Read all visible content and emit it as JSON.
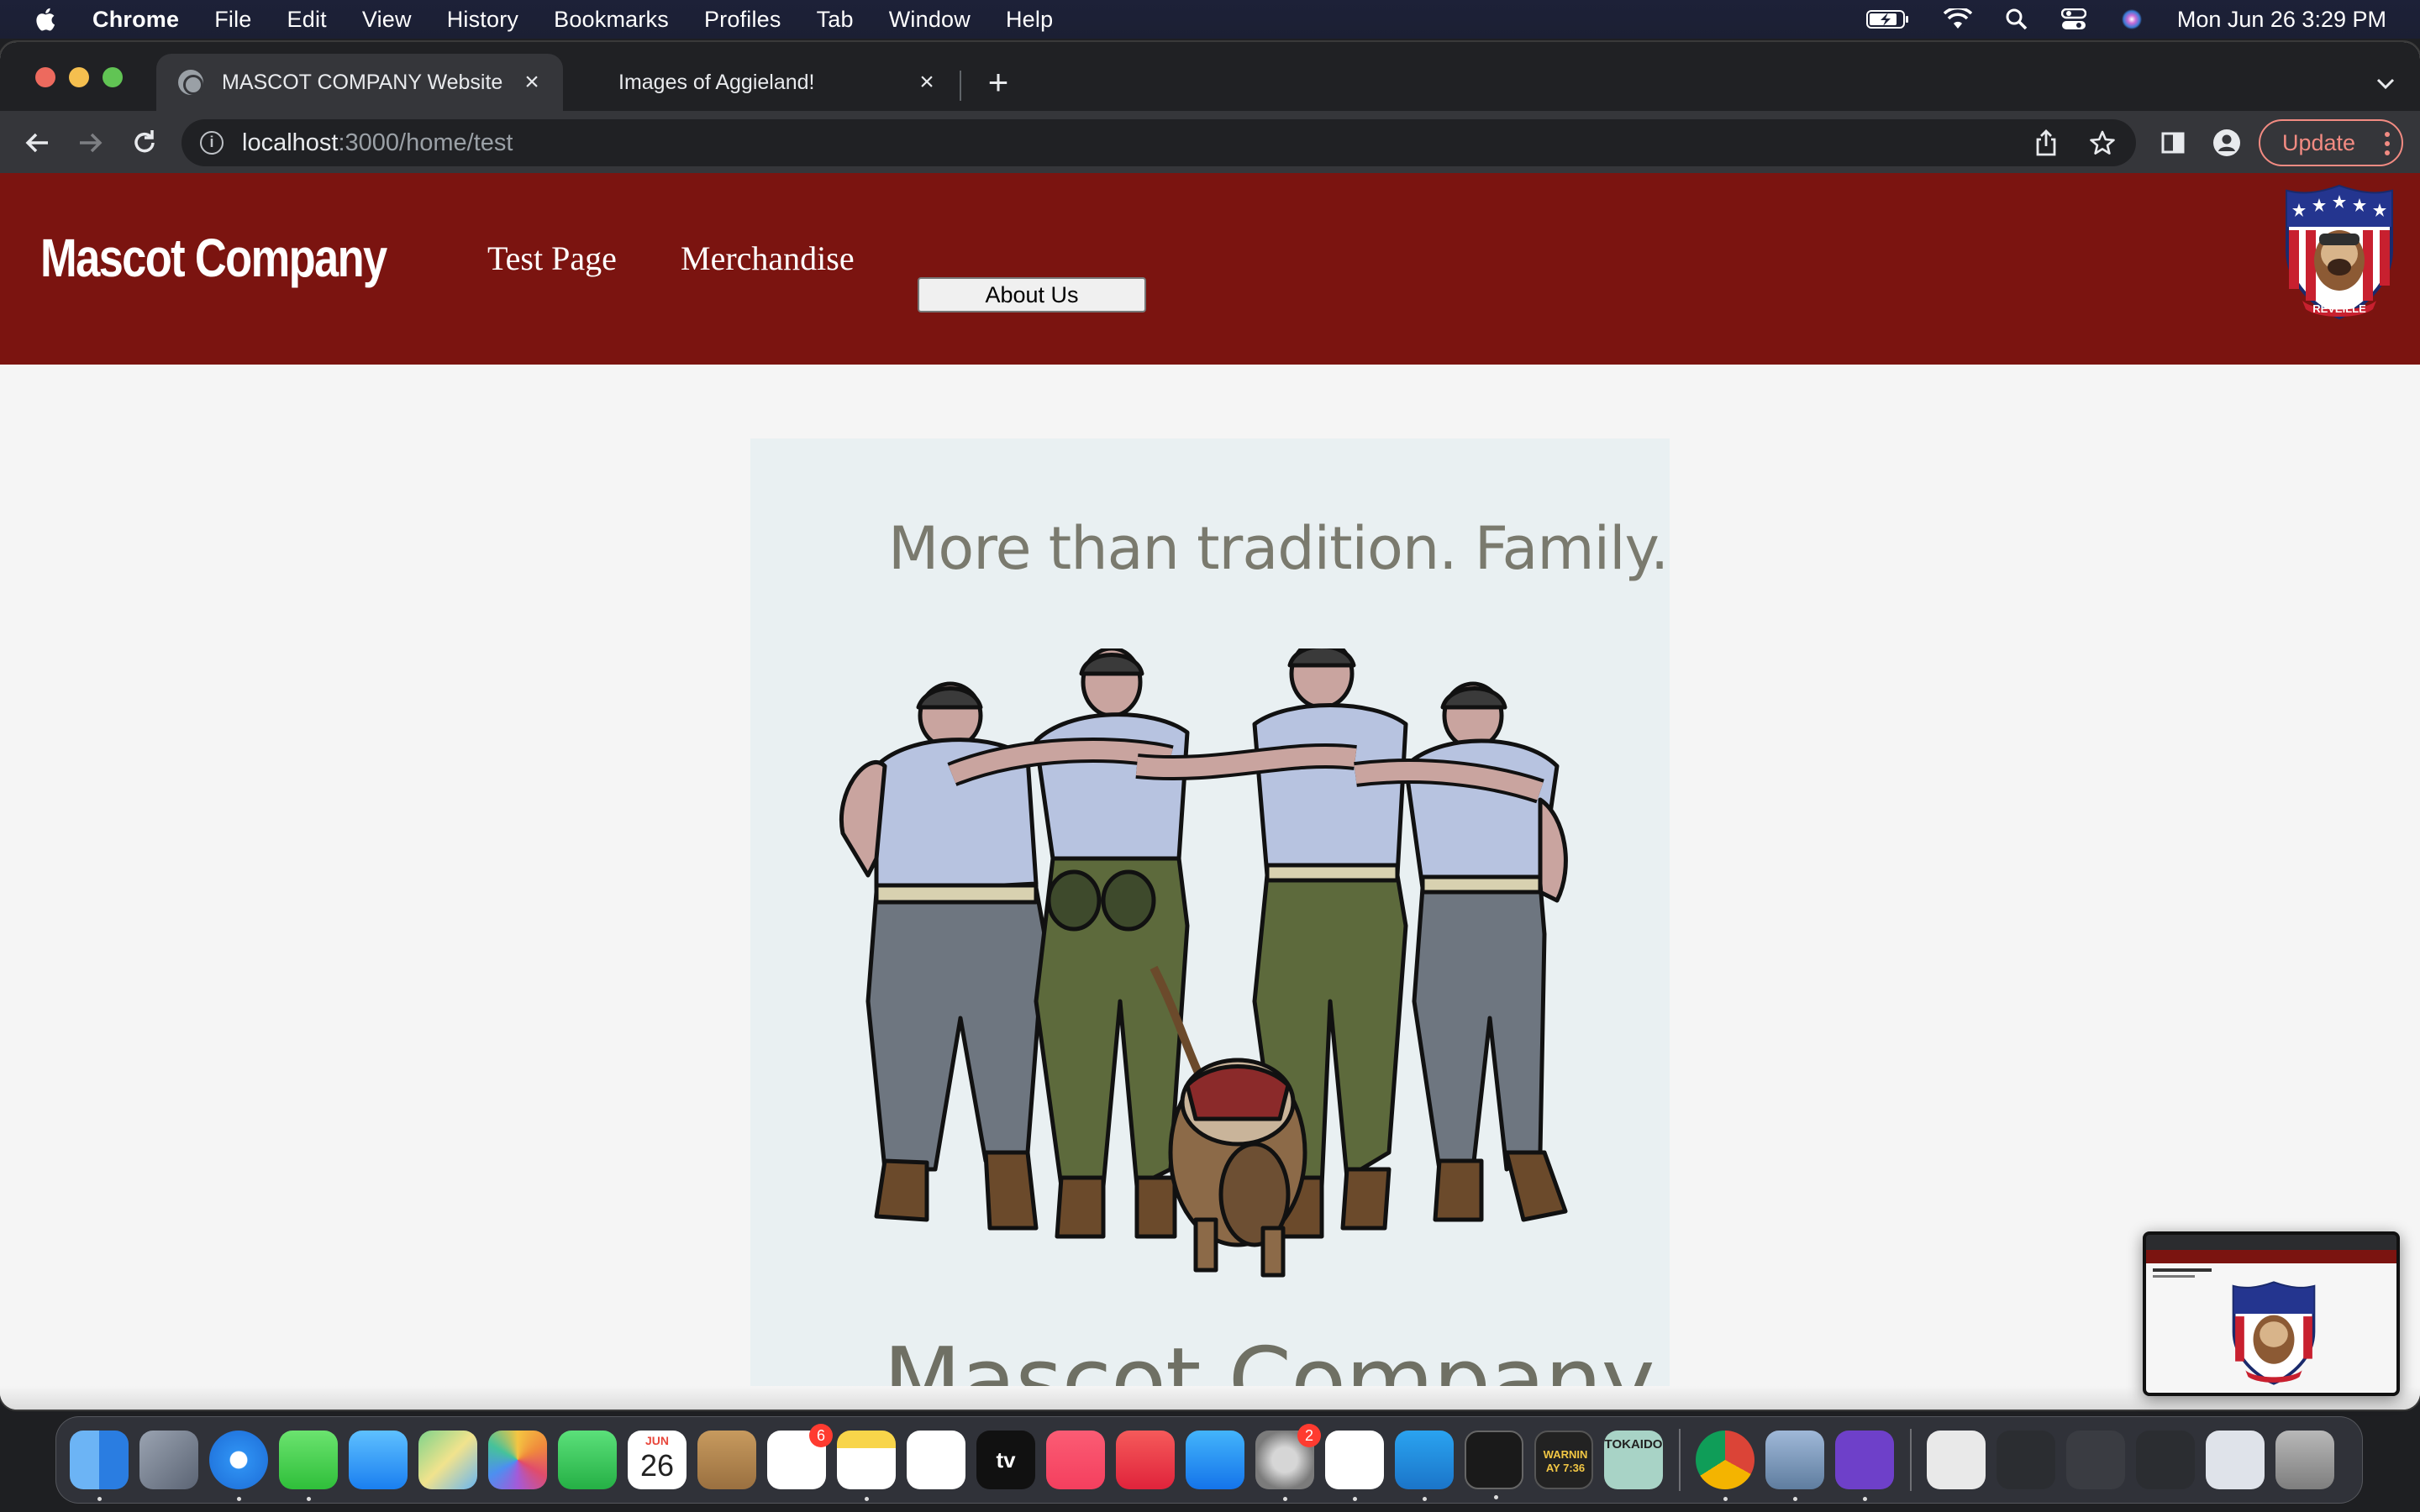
{
  "menubar": {
    "app_name": "Chrome",
    "items": [
      "File",
      "Edit",
      "View",
      "History",
      "Bookmarks",
      "Profiles",
      "Tab",
      "Window",
      "Help"
    ],
    "clock": "Mon Jun 26  3:29 PM"
  },
  "browser": {
    "tabs": [
      {
        "title": "MASCOT COMPANY Website",
        "active": true
      },
      {
        "title": "Images of Aggieland!",
        "active": false
      }
    ],
    "close_glyph": "×",
    "new_tab_glyph": "+",
    "url": {
      "host": "localhost",
      "path": ":3000/home/test"
    },
    "update_label": "Update"
  },
  "site": {
    "logo_text": "Mascot Company",
    "nav": {
      "test_page": "Test Page",
      "merchandise": "Merchandise",
      "about_us": "About Us"
    },
    "hero": {
      "tagline": "More than tradition. Family.",
      "company": "Mascot Company"
    },
    "badge_text": "REVEILLE"
  },
  "dock": {
    "calendar": {
      "month": "JUN",
      "day": "26"
    },
    "badges": {
      "reminders": "6",
      "system_settings": "2"
    },
    "tv_label": "tv",
    "console_label": "WARNIN\nAY 7:36",
    "tokaido_label": "TOKAIDO"
  },
  "colors": {
    "header_maroon": "#7b1410",
    "page_bg": "#f5f5f5",
    "hero_bg": "#e9f0f2",
    "hero_text": "#7a7a6e",
    "update_accent": "#f28b82"
  }
}
